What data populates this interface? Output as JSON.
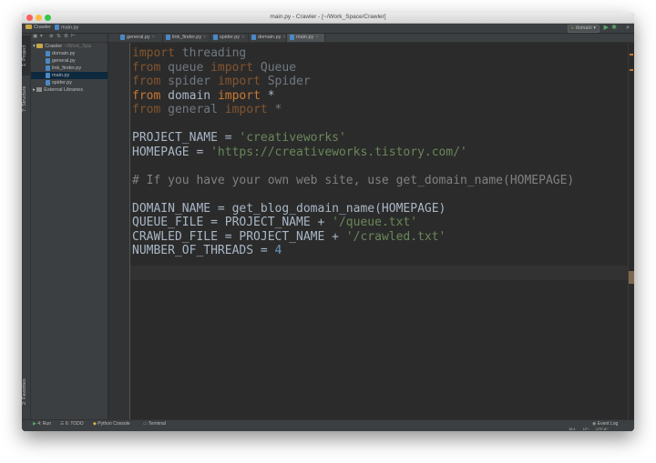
{
  "window": {
    "title": "main.py - Crawler - [~/Work_Space/Crawler]"
  },
  "navbar": {
    "breadcrumb": [
      {
        "label": "Crawler",
        "icon": "folder-icon"
      },
      {
        "label": "main.py",
        "icon": "python-file-icon"
      }
    ],
    "run_config": "domain",
    "icons": [
      "run-icon",
      "debug-icon",
      "search-icon"
    ]
  },
  "left_strip": {
    "project_tab": "1: Project",
    "structure_tab": "7: Structure",
    "favorites_tab": "2: Favorites"
  },
  "project_tree": {
    "root_label": "Crawler",
    "root_path": "~/Work_Spa",
    "files": [
      "domain.py",
      "general.py",
      "link_finder.py",
      "main.py",
      "spider.py"
    ],
    "selected": "main.py",
    "external": "External Libraries"
  },
  "tabs": [
    {
      "label": "general.py",
      "active": false
    },
    {
      "label": "link_finder.py",
      "active": false
    },
    {
      "label": "spider.py",
      "active": false
    },
    {
      "label": "domain.py",
      "active": false
    },
    {
      "label": "main.py",
      "active": true
    }
  ],
  "code": [
    [
      {
        "t": "import",
        "c": "kw"
      },
      {
        "t": " threading",
        "c": ""
      }
    ],
    [
      {
        "t": "from",
        "c": "kw"
      },
      {
        "t": " queue ",
        "c": ""
      },
      {
        "t": "import",
        "c": "kw"
      },
      {
        "t": " Queue",
        "c": ""
      }
    ],
    [
      {
        "t": "from",
        "c": "kw"
      },
      {
        "t": " spider ",
        "c": ""
      },
      {
        "t": "import",
        "c": "kw"
      },
      {
        "t": " Spider",
        "c": ""
      }
    ],
    [
      {
        "t": "from",
        "c": "kw"
      },
      {
        "t": " domain ",
        "c": ""
      },
      {
        "t": "import",
        "c": "kw"
      },
      {
        "t": " *",
        "c": ""
      }
    ],
    [
      {
        "t": "from",
        "c": "kw"
      },
      {
        "t": " general ",
        "c": ""
      },
      {
        "t": "import",
        "c": "kw"
      },
      {
        "t": " *",
        "c": ""
      }
    ],
    [],
    [
      {
        "t": "PROJECT_NAME = ",
        "c": ""
      },
      {
        "t": "'creativeworks'",
        "c": "str"
      }
    ],
    [
      {
        "t": "HOMEPAGE = ",
        "c": ""
      },
      {
        "t": "'https://creativeworks.tistory.com/'",
        "c": "str"
      }
    ],
    [],
    [
      {
        "t": "# If you have your own web site, use get_domain_name(HOMEPAGE)",
        "c": "cmt"
      }
    ],
    [],
    [
      {
        "t": "DOMAIN_NAME = get_blog_domain_name(HOMEPAGE)",
        "c": ""
      }
    ],
    [
      {
        "t": "QUEUE_FILE = PROJECT_NAME + ",
        "c": ""
      },
      {
        "t": "'/queue.txt'",
        "c": "str"
      }
    ],
    [
      {
        "t": "CRAWLED_FILE = PROJECT_NAME + ",
        "c": ""
      },
      {
        "t": "'/crawled.txt'",
        "c": "str"
      }
    ],
    [
      {
        "t": "NUMBER_OF_THREADS = ",
        "c": ""
      },
      {
        "t": "4",
        "c": "num"
      }
    ]
  ],
  "bottom_tools": [
    {
      "label": "4: Run",
      "icon": "run-icon"
    },
    {
      "label": "6: TODO",
      "icon": "todo-icon"
    },
    {
      "label": "Python Console",
      "icon": "python-console-icon"
    },
    {
      "label": "Terminal",
      "icon": "terminal-icon"
    }
  ],
  "status": {
    "position": "16:1",
    "line_sep": "LF÷",
    "encoding": "UTF-8÷",
    "event_log": "Event Log"
  },
  "colors": {
    "keyword": "#cc7832",
    "string": "#6a8759",
    "number": "#6897bb",
    "comment": "#808080",
    "text": "#a9b7c6",
    "background": "#2b2b2b"
  }
}
